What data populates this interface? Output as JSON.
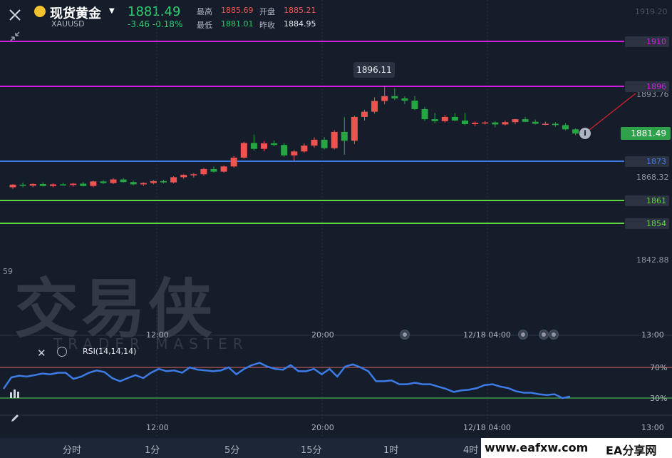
{
  "header": {
    "title": "现货黄金",
    "symbol": "XAUUSD",
    "price": "1881.49",
    "change": "-3.46",
    "change_pct": "-0.18%",
    "high_label": "最高",
    "high": "1885.69",
    "open_label": "开盘",
    "open": "1885.21",
    "low_label": "最低",
    "low": "1881.01",
    "prev_close_label": "昨收",
    "prev_close": "1884.95"
  },
  "levels": {
    "l1910": "1910",
    "l1896": "1896",
    "l1873": "1873",
    "l1861": "1861",
    "l1854": "1854",
    "current": "1881.49"
  },
  "axis": {
    "y_top": "1919.20",
    "y_mid1": "1893.76",
    "y_mid2": "1868.32",
    "y_low": "1842.88",
    "y_left": "59",
    "peak_label": "1896.11",
    "rsi_70": "70%",
    "rsi_30": "30%",
    "rsi_label": "RSI(14,14,14)"
  },
  "time_axis": {
    "t1": "12:00",
    "t2": "20:00",
    "t3": "12/18 04:00",
    "t4": "13:00"
  },
  "watermark": {
    "cn": "交易侠",
    "en": "TRADER MASTER"
  },
  "footer": {
    "tabs": [
      "分时",
      "1分",
      "5分",
      "15分",
      "1时",
      "4时"
    ],
    "brand": "www.eafxw.com",
    "brand2": "EA分享网"
  },
  "colors": {
    "up": "#ef5350",
    "down": "#26a643",
    "magenta": "#d21ee0",
    "blue": "#3d7be6",
    "green": "#5ed63e",
    "rsi_line": "#3d7be6"
  },
  "chart_data": {
    "type": "candlestick",
    "candles": [
      [
        1865.0,
        1866.0,
        1864.5,
        1865.8
      ],
      [
        1865.8,
        1866.5,
        1865.0,
        1865.5
      ],
      [
        1865.5,
        1866.2,
        1865.0,
        1866.0
      ],
      [
        1866.0,
        1866.5,
        1865.2,
        1865.4
      ],
      [
        1865.4,
        1866.2,
        1865.0,
        1865.9
      ],
      [
        1865.9,
        1866.4,
        1865.5,
        1865.7
      ],
      [
        1865.7,
        1866.3,
        1865.2,
        1866.1
      ],
      [
        1866.1,
        1866.6,
        1865.2,
        1865.4
      ],
      [
        1865.4,
        1867.0,
        1865.0,
        1866.8
      ],
      [
        1866.8,
        1867.2,
        1866.0,
        1866.3
      ],
      [
        1866.3,
        1867.8,
        1866.0,
        1867.4
      ],
      [
        1867.4,
        1867.9,
        1866.4,
        1866.6
      ],
      [
        1866.6,
        1867.0,
        1865.6,
        1865.9
      ],
      [
        1865.9,
        1866.6,
        1865.4,
        1866.3
      ],
      [
        1866.3,
        1867.2,
        1865.9,
        1866.9
      ],
      [
        1866.9,
        1867.3,
        1866.2,
        1866.5
      ],
      [
        1866.5,
        1868.4,
        1866.2,
        1868.1
      ],
      [
        1868.1,
        1869.0,
        1867.6,
        1868.8
      ],
      [
        1868.8,
        1869.4,
        1868.0,
        1869.0
      ],
      [
        1869.0,
        1871.0,
        1868.5,
        1870.6
      ],
      [
        1870.6,
        1871.4,
        1869.5,
        1869.8
      ],
      [
        1869.8,
        1871.7,
        1869.5,
        1871.4
      ],
      [
        1871.4,
        1874.6,
        1871.0,
        1874.1
      ],
      [
        1874.1,
        1879.0,
        1873.8,
        1878.6
      ],
      [
        1878.6,
        1881.2,
        1876.3,
        1876.8
      ],
      [
        1876.8,
        1879.2,
        1876.0,
        1878.5
      ],
      [
        1878.5,
        1879.4,
        1877.6,
        1878.0
      ],
      [
        1878.0,
        1878.6,
        1874.4,
        1874.8
      ],
      [
        1874.8,
        1876.5,
        1873.2,
        1876.0
      ],
      [
        1876.0,
        1878.5,
        1875.6,
        1877.8
      ],
      [
        1877.8,
        1880.3,
        1877.2,
        1879.6
      ],
      [
        1879.6,
        1880.4,
        1876.6,
        1877.0
      ],
      [
        1877.0,
        1882.5,
        1876.6,
        1882.0
      ],
      [
        1882.0,
        1886.5,
        1875.0,
        1879.3
      ],
      [
        1879.3,
        1887.0,
        1878.3,
        1886.6
      ],
      [
        1886.6,
        1888.8,
        1885.5,
        1888.2
      ],
      [
        1888.2,
        1892.6,
        1887.6,
        1891.5
      ],
      [
        1891.5,
        1896.1,
        1890.5,
        1893.0
      ],
      [
        1893.0,
        1895.4,
        1891.8,
        1892.3
      ],
      [
        1892.3,
        1892.9,
        1890.6,
        1891.6
      ],
      [
        1891.6,
        1893.0,
        1888.7,
        1889.0
      ],
      [
        1889.0,
        1889.7,
        1885.4,
        1885.9
      ],
      [
        1885.9,
        1887.8,
        1884.6,
        1885.3
      ],
      [
        1885.3,
        1887.2,
        1884.9,
        1886.6
      ],
      [
        1886.6,
        1887.8,
        1885.3,
        1885.5
      ],
      [
        1885.5,
        1887.9,
        1884.0,
        1884.4
      ],
      [
        1884.4,
        1885.2,
        1883.8,
        1884.8
      ],
      [
        1884.8,
        1885.3,
        1884.3,
        1884.9
      ],
      [
        1884.9,
        1885.3,
        1883.4,
        1884.3
      ],
      [
        1884.3,
        1885.5,
        1884.0,
        1885.0
      ],
      [
        1885.0,
        1886.0,
        1884.4,
        1885.9
      ],
      [
        1885.9,
        1886.6,
        1885.0,
        1885.1
      ],
      [
        1885.1,
        1885.8,
        1884.3,
        1884.5
      ],
      [
        1884.5,
        1885.2,
        1884.0,
        1884.5
      ],
      [
        1884.5,
        1885.0,
        1883.6,
        1884.1
      ],
      [
        1884.1,
        1884.7,
        1882.5,
        1882.8
      ],
      [
        1882.8,
        1883.1,
        1881.0,
        1881.5
      ]
    ],
    "rsi": [
      42,
      57,
      59,
      58,
      60,
      62,
      61,
      63,
      63,
      55,
      58,
      63,
      66,
      64,
      56,
      52,
      56,
      60,
      56,
      63,
      68,
      65,
      66,
      63,
      70,
      67,
      66,
      65,
      66,
      70,
      61,
      68,
      73,
      76,
      71,
      68,
      67,
      73,
      65,
      65,
      68,
      61,
      68,
      58,
      71,
      74,
      70,
      65,
      52,
      52,
      53,
      48,
      48,
      50,
      48,
      48,
      45,
      42,
      38,
      40,
      41,
      43,
      47,
      48,
      45,
      43,
      39,
      37,
      37,
      35,
      34,
      35,
      30,
      32
    ],
    "y_ticks": [
      "1919.20",
      "1893.76",
      "1868.32",
      "1842.88"
    ]
  }
}
